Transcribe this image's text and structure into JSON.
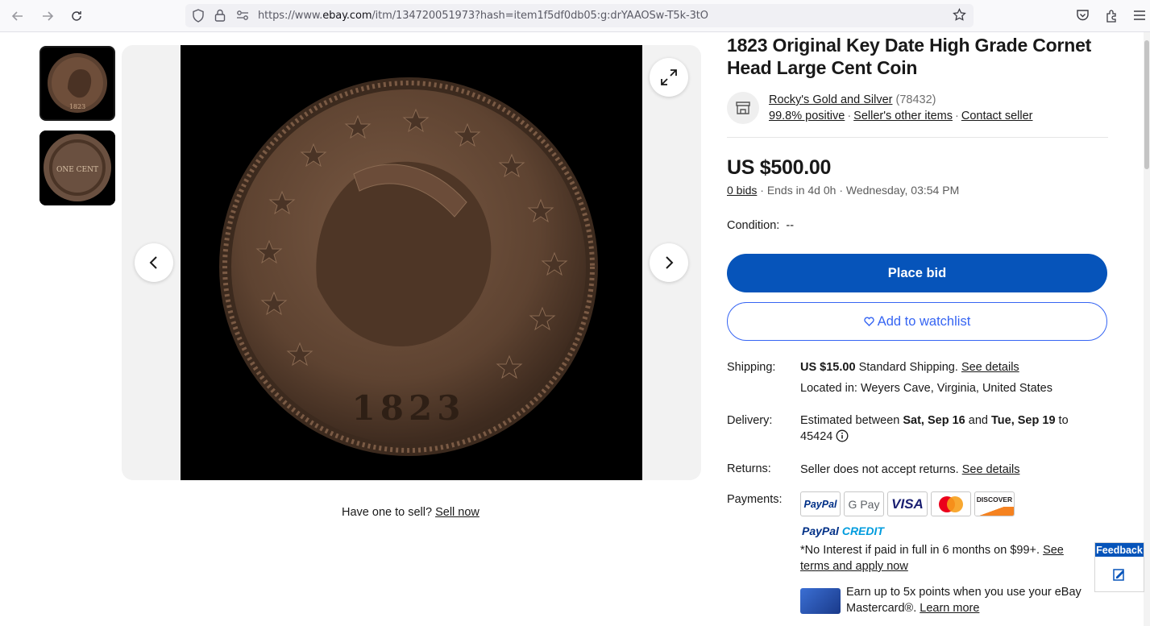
{
  "browser": {
    "url_prefix": "https://www.",
    "url_domain": "ebay.com",
    "url_rest": "/itm/134720051973?hash=item1f5df0db05:g:drYAAOSw-T5k-3tO"
  },
  "listing": {
    "title": "1823 Original Key Date High Grade Cornet Head Large Cent Coin",
    "seller": {
      "name": "Rocky's Gold and Silver",
      "feedback_count": "(78432)",
      "positive": "99.8% positive",
      "other_items": "Seller's other items",
      "contact": "Contact seller"
    },
    "price": "US $500.00",
    "bids": "0 bids",
    "ends": "Ends in 4d 0h",
    "end_time": "Wednesday, 03:54 PM",
    "condition_label": "Condition:",
    "condition_value": "--",
    "place_bid": "Place bid",
    "watchlist": "Add to watchlist"
  },
  "coin": {
    "thumb_year": "1823",
    "reverse_text": "ONE CENT"
  },
  "gallery": {
    "sell_prompt": "Have one to sell?",
    "sell_link": "Sell now"
  },
  "shipping": {
    "label": "Shipping:",
    "cost": "US $15.00",
    "method": "Standard Shipping.",
    "details": "See details",
    "location": "Located in: Weyers Cave, Virginia, United States"
  },
  "delivery": {
    "label": "Delivery:",
    "pre": "Estimated between",
    "start": "Sat, Sep 16",
    "mid": "and",
    "end": "Tue, Sep 19",
    "post": "to",
    "zip": "45424"
  },
  "returns": {
    "label": "Returns:",
    "text": "Seller does not accept returns.",
    "details": "See details"
  },
  "payments": {
    "label": "Payments:",
    "logos": [
      "PayPal",
      "G Pay",
      "VISA",
      "Mastercard",
      "DISCOVER"
    ],
    "paypal_credit_1": "PayPal",
    "paypal_credit_2": "CREDIT",
    "credit_text": "*No Interest if paid in full in 6 months on $99+.",
    "credit_link": "See terms and apply now",
    "card_text": "Earn up to 5x points when you use your eBay Mastercard®.",
    "card_link": "Learn more"
  },
  "feedback": {
    "label": "Feedback"
  },
  "colors": {
    "primary": "#0654ba",
    "link_blue": "#3665f3",
    "coin_bg": "#000000"
  }
}
